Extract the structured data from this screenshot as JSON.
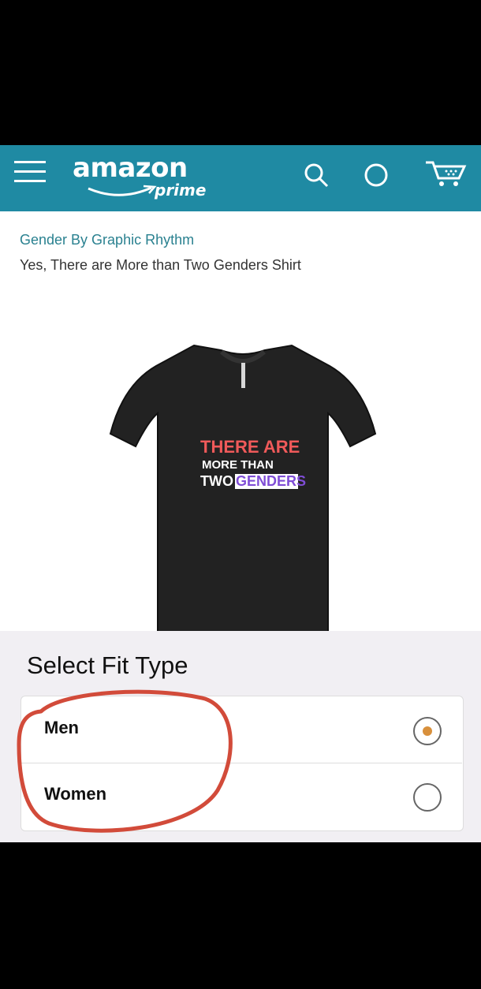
{
  "header": {
    "logo_text": "amazon",
    "logo_sub": "prime",
    "icons": [
      "menu-icon",
      "search-icon",
      "circle-icon",
      "cart-icon"
    ],
    "accent": "#1f8aa3"
  },
  "product": {
    "brand": "Gender By Graphic Rhythm",
    "title": "Yes, There are More than Two Genders Shirt",
    "shirt_text_lines": [
      "THERE ARE",
      "MORE THAN",
      "TWO",
      "GENDERS"
    ]
  },
  "fit": {
    "heading": "Select Fit Type",
    "options": [
      {
        "label": "Men",
        "selected": true
      },
      {
        "label": "Women",
        "selected": false
      }
    ]
  }
}
